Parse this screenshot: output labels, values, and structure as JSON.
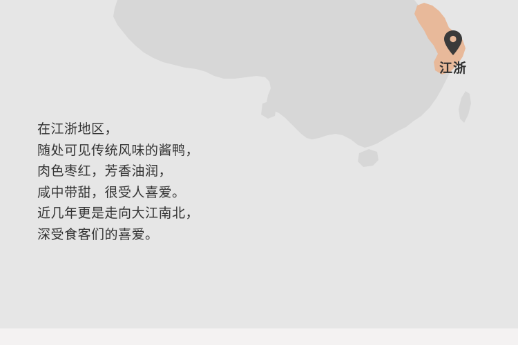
{
  "map": {
    "region_label": "江浙",
    "land_color": "#d7d7d7",
    "highlight_color": "#e8b99a",
    "pin_color": "#3a3a3a",
    "pin_icon": "map-pin-icon"
  },
  "description": {
    "lines": [
      "在江浙地区，",
      "随处可见传统风味的酱鸭，",
      "肉色枣红，芳香油润，",
      "咸中带甜，很受人喜爱。",
      "近几年更是走向大江南北，",
      "深受食客们的喜爱。"
    ]
  },
  "colors": {
    "background": "#e6e6e6",
    "text": "#333333",
    "footer": "#f4f2f2"
  }
}
